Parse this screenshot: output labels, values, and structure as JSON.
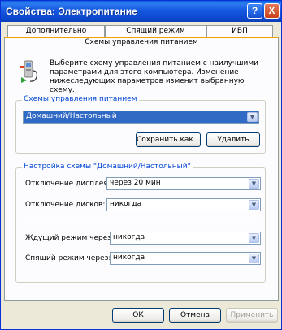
{
  "window": {
    "title": "Свойства: Электропитание"
  },
  "title_buttons": {
    "help": "?",
    "close": "X"
  },
  "tabs": {
    "row1": [
      "Дополнительно",
      "Спящий режим",
      "ИБП"
    ],
    "active": "Схемы управления питанием"
  },
  "intro": {
    "text": "Выберите схему управления питанием с наилучшими параметрами для этого компьютера. Изменение нижеследующих параметров изменит выбранную схему."
  },
  "scheme_group": {
    "title": "Схемы управления питанием",
    "selected_scheme": "Домашний/Настольный",
    "save_as_label": "Сохранить как...",
    "delete_label": "Удалить"
  },
  "settings_group": {
    "title": "Настройка схемы \"Домашний/Настольный\"",
    "rows": [
      {
        "label": "Отключение дисплея:",
        "value": "через 20 мин"
      },
      {
        "label": "Отключение дисков:",
        "value": "никогда"
      },
      {
        "label": "Ждущий режим через:",
        "value": "никогда"
      },
      {
        "label": "Спящий режим через:",
        "value": "никогда"
      }
    ]
  },
  "footer": {
    "ok": "ОК",
    "cancel": "Отмена",
    "apply": "Применить"
  },
  "colors": {
    "titlebar": "#0a5fd9",
    "selection": "#316ac5",
    "group_title": "#0046d5"
  },
  "icons": {
    "power": "power-plug-icon"
  }
}
